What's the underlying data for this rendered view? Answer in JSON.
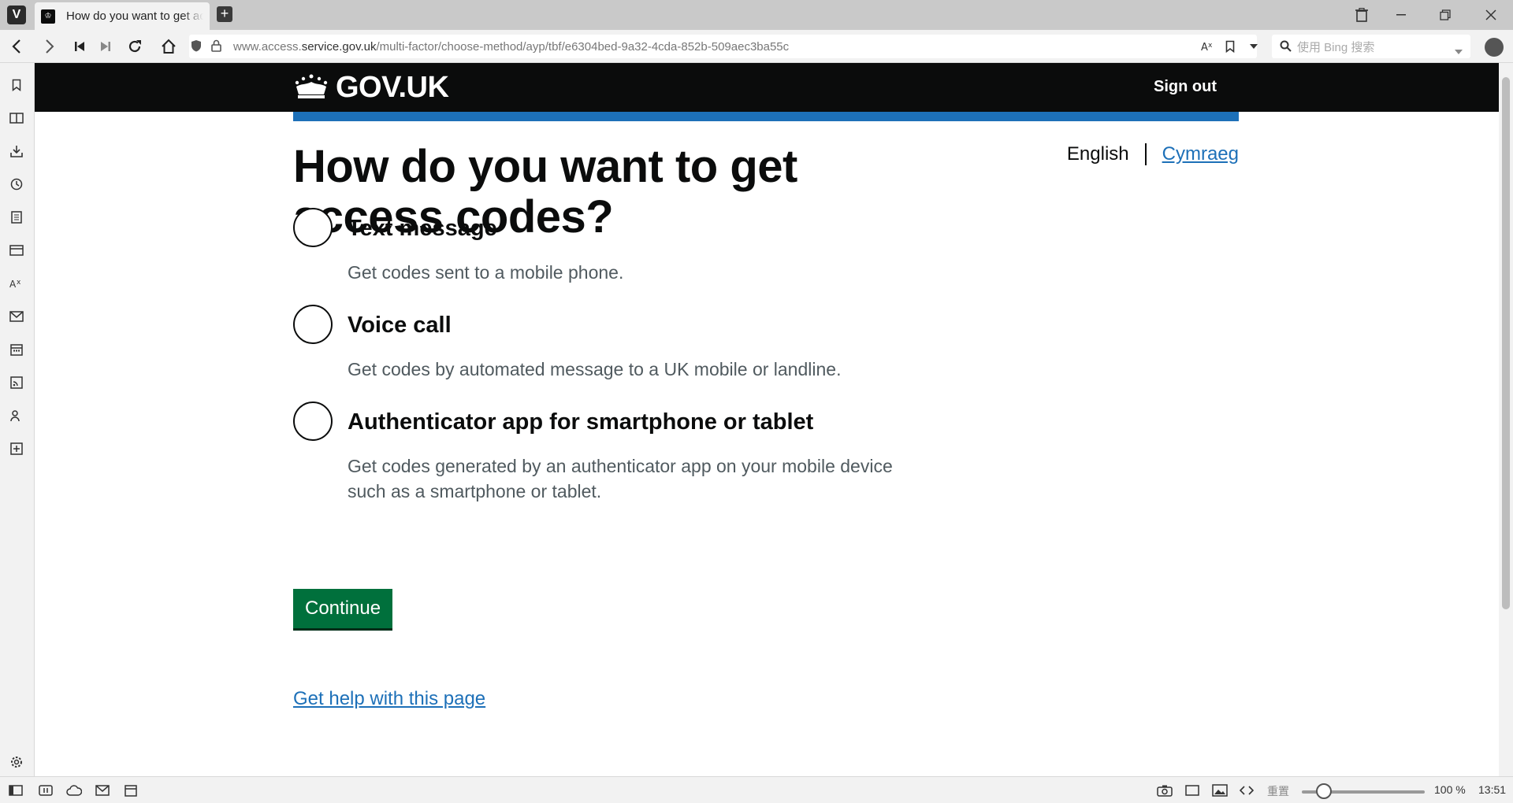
{
  "browser": {
    "tab_title": "How do you want to get access codes?",
    "url_prefix": "www.access.",
    "url_host": "service.gov.uk",
    "url_path": "/multi-factor/choose-method/ayp/tbf/e6304bed-9a32-4cda-852b-509aec3ba55c",
    "search_placeholder": "使用 Bing 搜索",
    "reset_label": "重置",
    "zoom": "100 %",
    "clock": "13:51"
  },
  "header": {
    "logo": "GOV.UK",
    "sign_out": "Sign out"
  },
  "page": {
    "title": "How do you want to get access codes?",
    "lang_current": "English",
    "lang_other": "Cymraeg",
    "options": [
      {
        "label": "Text message",
        "hint": "Get codes sent to a mobile phone."
      },
      {
        "label": "Voice call",
        "hint": "Get codes by automated message to a UK mobile or landline."
      },
      {
        "label": "Authenticator app for smartphone or tablet",
        "hint": "Get codes generated by an authenticator app on your mobile device such as a smartphone or tablet."
      }
    ],
    "continue": "Continue",
    "help_link": "Get help with this page"
  }
}
